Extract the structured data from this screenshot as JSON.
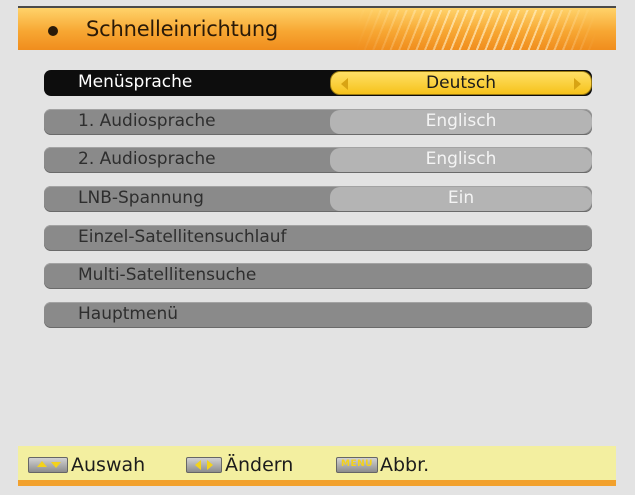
{
  "header": {
    "title": "Schnelleinrichtung"
  },
  "menu": {
    "items": [
      {
        "label": "Menüsprache",
        "value": "Deutsch",
        "selected": true
      },
      {
        "label": "1. Audiosprache",
        "value": "Englisch",
        "selected": false
      },
      {
        "label": "2. Audiosprache",
        "value": "Englisch",
        "selected": false
      },
      {
        "label": "LNB-Spannung",
        "value": "Ein",
        "selected": false
      },
      {
        "label": "Einzel-Satellitensuchlauf"
      },
      {
        "label": "Multi-Satellitensuche"
      },
      {
        "label": "Hauptmenü"
      }
    ]
  },
  "footer": {
    "select_label": "Auswah",
    "change_label": "Ändern",
    "menu_key_label": "MENU",
    "cancel_label": "Abbr."
  },
  "colors": {
    "header_orange": "#f7a733",
    "selected_value_yellow": "#f6c21b",
    "item_gray": "#8a8a8a",
    "footer_yellow": "#f3efa0"
  }
}
